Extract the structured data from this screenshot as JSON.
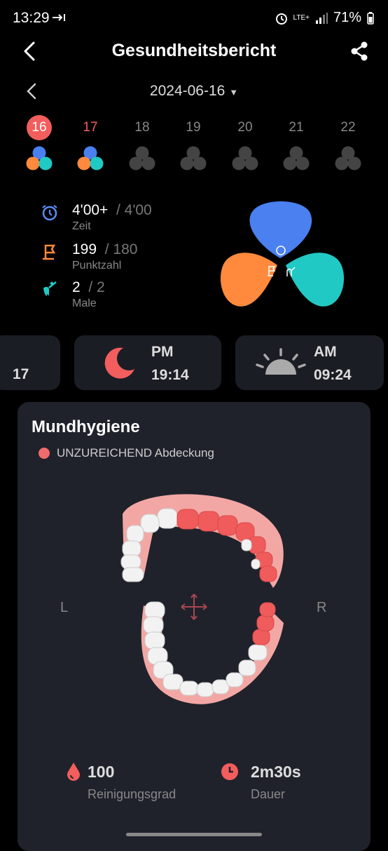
{
  "status": {
    "time": "13:29",
    "network": "LTE+",
    "battery": "71%"
  },
  "header": {
    "title": "Gesundheitsbericht"
  },
  "date": {
    "label": "2024-06-16"
  },
  "days": [
    {
      "num": "16",
      "state": "selected",
      "active": true
    },
    {
      "num": "17",
      "state": "red",
      "active": true
    },
    {
      "num": "18",
      "state": "",
      "active": false
    },
    {
      "num": "19",
      "state": "",
      "active": false
    },
    {
      "num": "20",
      "state": "",
      "active": false
    },
    {
      "num": "21",
      "state": "",
      "active": false
    },
    {
      "num": "22",
      "state": "",
      "active": false
    }
  ],
  "stats": {
    "time": {
      "value": "4'00+",
      "target": "/ 4'00",
      "label": "Zeit"
    },
    "score": {
      "value": "199",
      "target": "/ 180",
      "label": "Punktzahl"
    },
    "count": {
      "value": "2",
      "target": "/ 2",
      "label": "Male"
    }
  },
  "sessions": [
    {
      "period": "",
      "time": "17"
    },
    {
      "period": "PM",
      "time": "19:14"
    },
    {
      "period": "AM",
      "time": "09:24"
    }
  ],
  "hygiene": {
    "title": "Mundhygiene",
    "legend": "UNZUREICHEND Abdeckung",
    "left": "L",
    "right": "R",
    "cleaning_value": "100",
    "cleaning_label": "Reinigungsgrad",
    "duration_value": "2m30s",
    "duration_label": "Dauer"
  },
  "colors": {
    "accent": "#f25d5d",
    "blue": "#4a7ef0",
    "orange": "#ff8a3d",
    "teal": "#21c9c4"
  }
}
